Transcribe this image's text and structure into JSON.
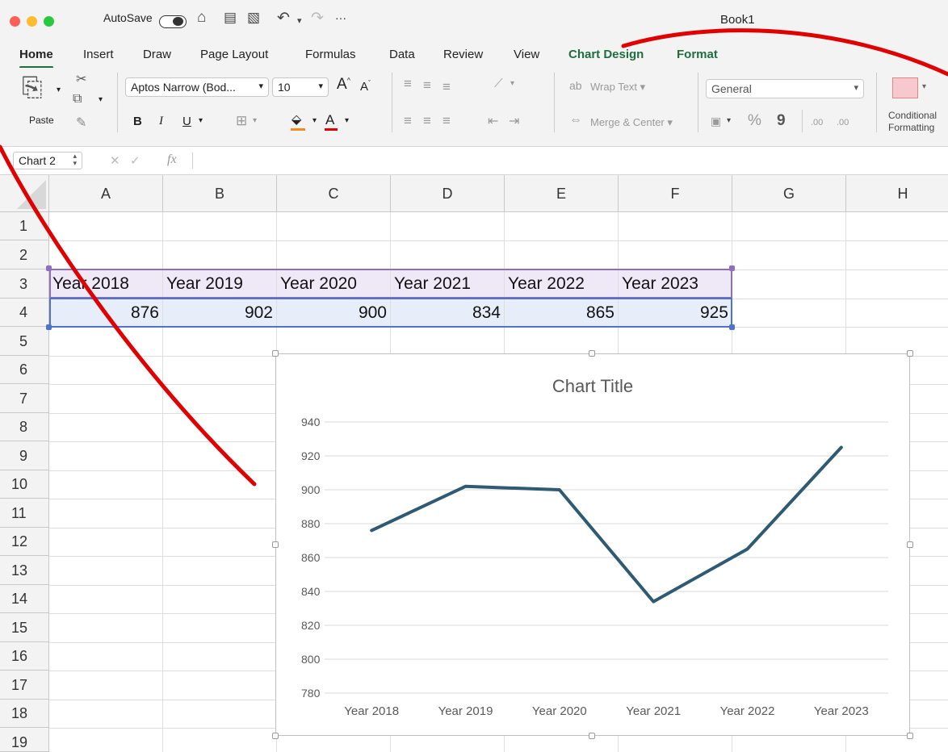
{
  "window": {
    "title": "Book1",
    "autosave_label": "AutoSave",
    "more_label": "···"
  },
  "tabs": [
    "Home",
    "Insert",
    "Draw",
    "Page Layout",
    "Formulas",
    "Data",
    "Review",
    "View",
    "Chart Design",
    "Format"
  ],
  "ribbon": {
    "paste_label": "Paste",
    "font_name": "Aptos Narrow (Bod...",
    "font_size": "10",
    "bold": "B",
    "italic": "I",
    "underline": "U",
    "grow_font": "A",
    "shrink_font": "A",
    "font_color": "A",
    "wrap_text": "Wrap Text",
    "merge_center": "Merge & Center",
    "number_format": "General",
    "percent": "%",
    "comma": "9",
    "inc_decimal": ".00",
    "dec_decimal": ".00",
    "conditional_formatting": [
      "Conditional",
      "Formatting"
    ]
  },
  "formula_bar": {
    "name_box": "Chart 2",
    "fx": "fx",
    "cancel": "✕",
    "enter": "✓"
  },
  "sheet": {
    "columns": [
      "A",
      "B",
      "C",
      "D",
      "E",
      "F",
      "G",
      "H"
    ],
    "rows": [
      "1",
      "2",
      "3",
      "4",
      "5",
      "6",
      "7",
      "8",
      "9",
      "10",
      "11",
      "12",
      "13",
      "14",
      "15",
      "16",
      "17",
      "18",
      "19"
    ],
    "row3": [
      "Year 2018",
      "Year 2019",
      "Year 2020",
      "Year 2021",
      "Year 2022",
      "Year 2023"
    ],
    "row4": [
      "876",
      "902",
      "900",
      "834",
      "865",
      "925"
    ]
  },
  "chart_data": {
    "type": "line",
    "title": "Chart Title",
    "categories": [
      "Year 2018",
      "Year 2019",
      "Year 2020",
      "Year 2021",
      "Year 2022",
      "Year 2023"
    ],
    "values": [
      876,
      902,
      900,
      834,
      865,
      925
    ],
    "ylim": [
      780,
      940
    ],
    "yticks": [
      "780",
      "800",
      "820",
      "840",
      "860",
      "880",
      "900",
      "920",
      "940"
    ],
    "grid": true,
    "line_color": "#2e5a72"
  },
  "annotation": {
    "color": "#e00000"
  }
}
